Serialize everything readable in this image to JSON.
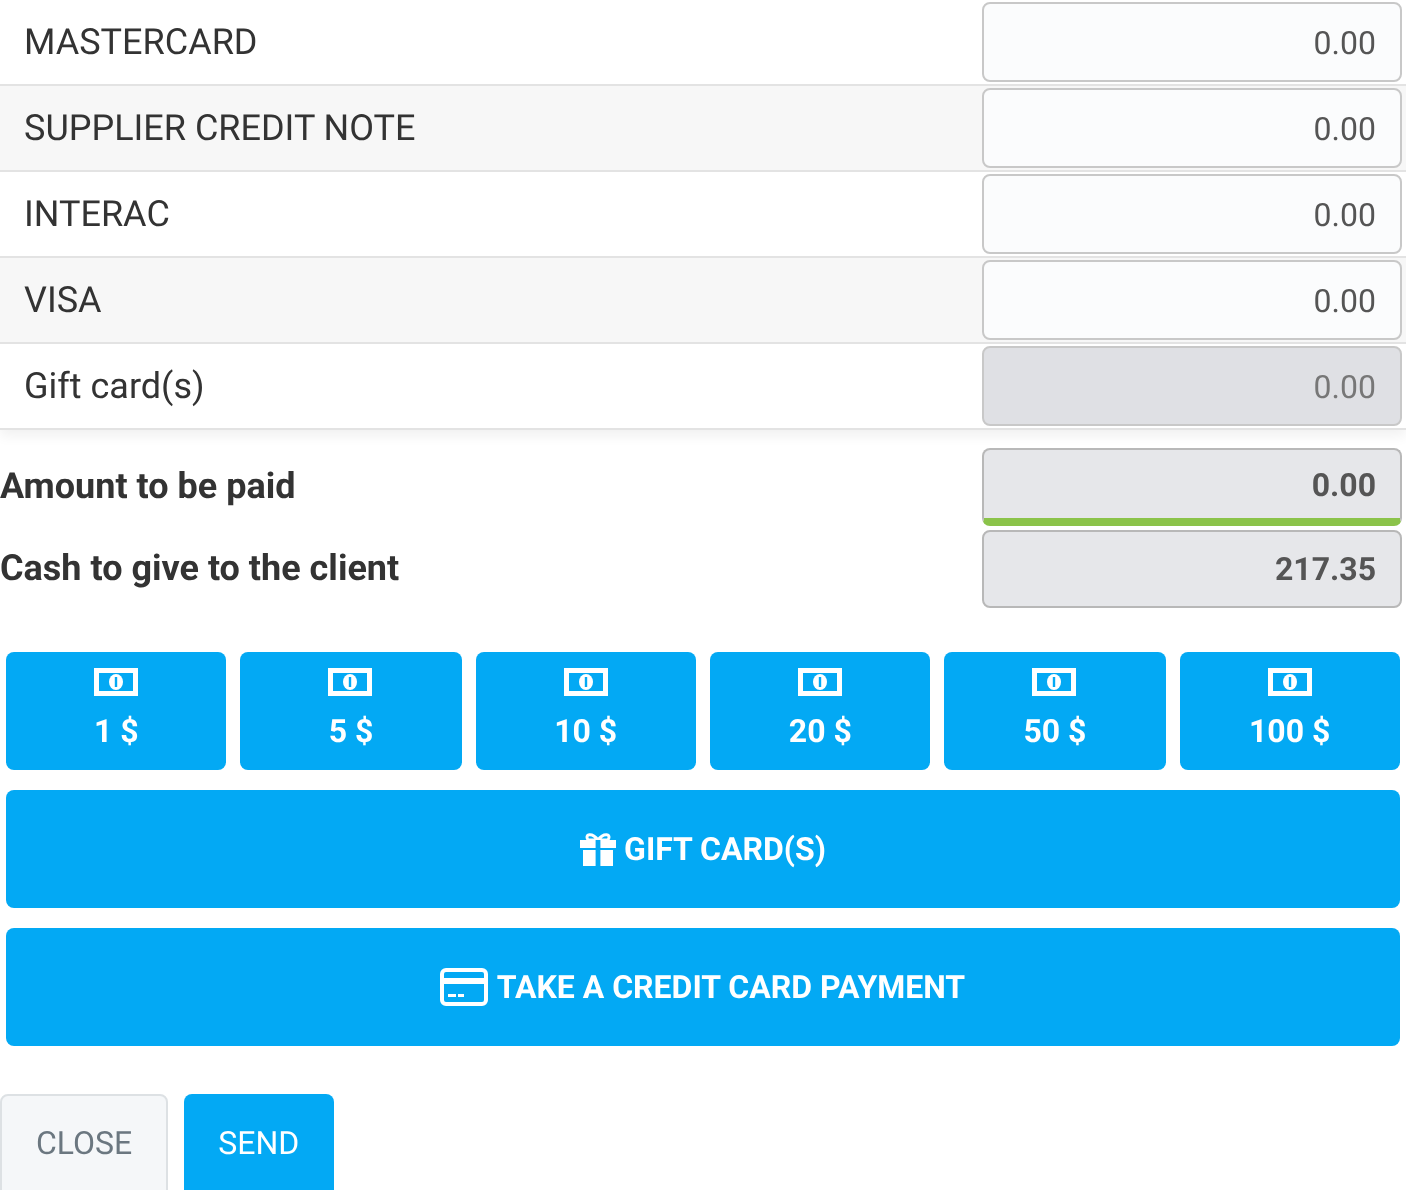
{
  "payment_methods": [
    {
      "label": "MASTERCARD",
      "value": "0.00",
      "disabled": false
    },
    {
      "label": "SUPPLIER CREDIT NOTE",
      "value": "0.00",
      "disabled": false
    },
    {
      "label": "INTERAC",
      "value": "0.00",
      "disabled": false
    },
    {
      "label": "VISA",
      "value": "0.00",
      "disabled": false
    },
    {
      "label": "Gift card(s)",
      "value": "0.00",
      "disabled": true
    }
  ],
  "summary": [
    {
      "label": "Amount to be paid",
      "value": "0.00",
      "settled": true
    },
    {
      "label": "Cash to give to the client",
      "value": "217.35",
      "settled": false
    }
  ],
  "cash_buttons": [
    "1 $",
    "5 $",
    "10 $",
    "20 $",
    "50 $",
    "100 $"
  ],
  "actions": [
    {
      "kind": "gift",
      "label": "GIFT CARD(S)"
    },
    {
      "kind": "credit",
      "label": "TAKE A CREDIT CARD PAYMENT"
    }
  ],
  "footer_buttons": [
    {
      "kind": "secondary",
      "label": "CLOSE"
    },
    {
      "kind": "primary",
      "label": "SEND"
    }
  ]
}
